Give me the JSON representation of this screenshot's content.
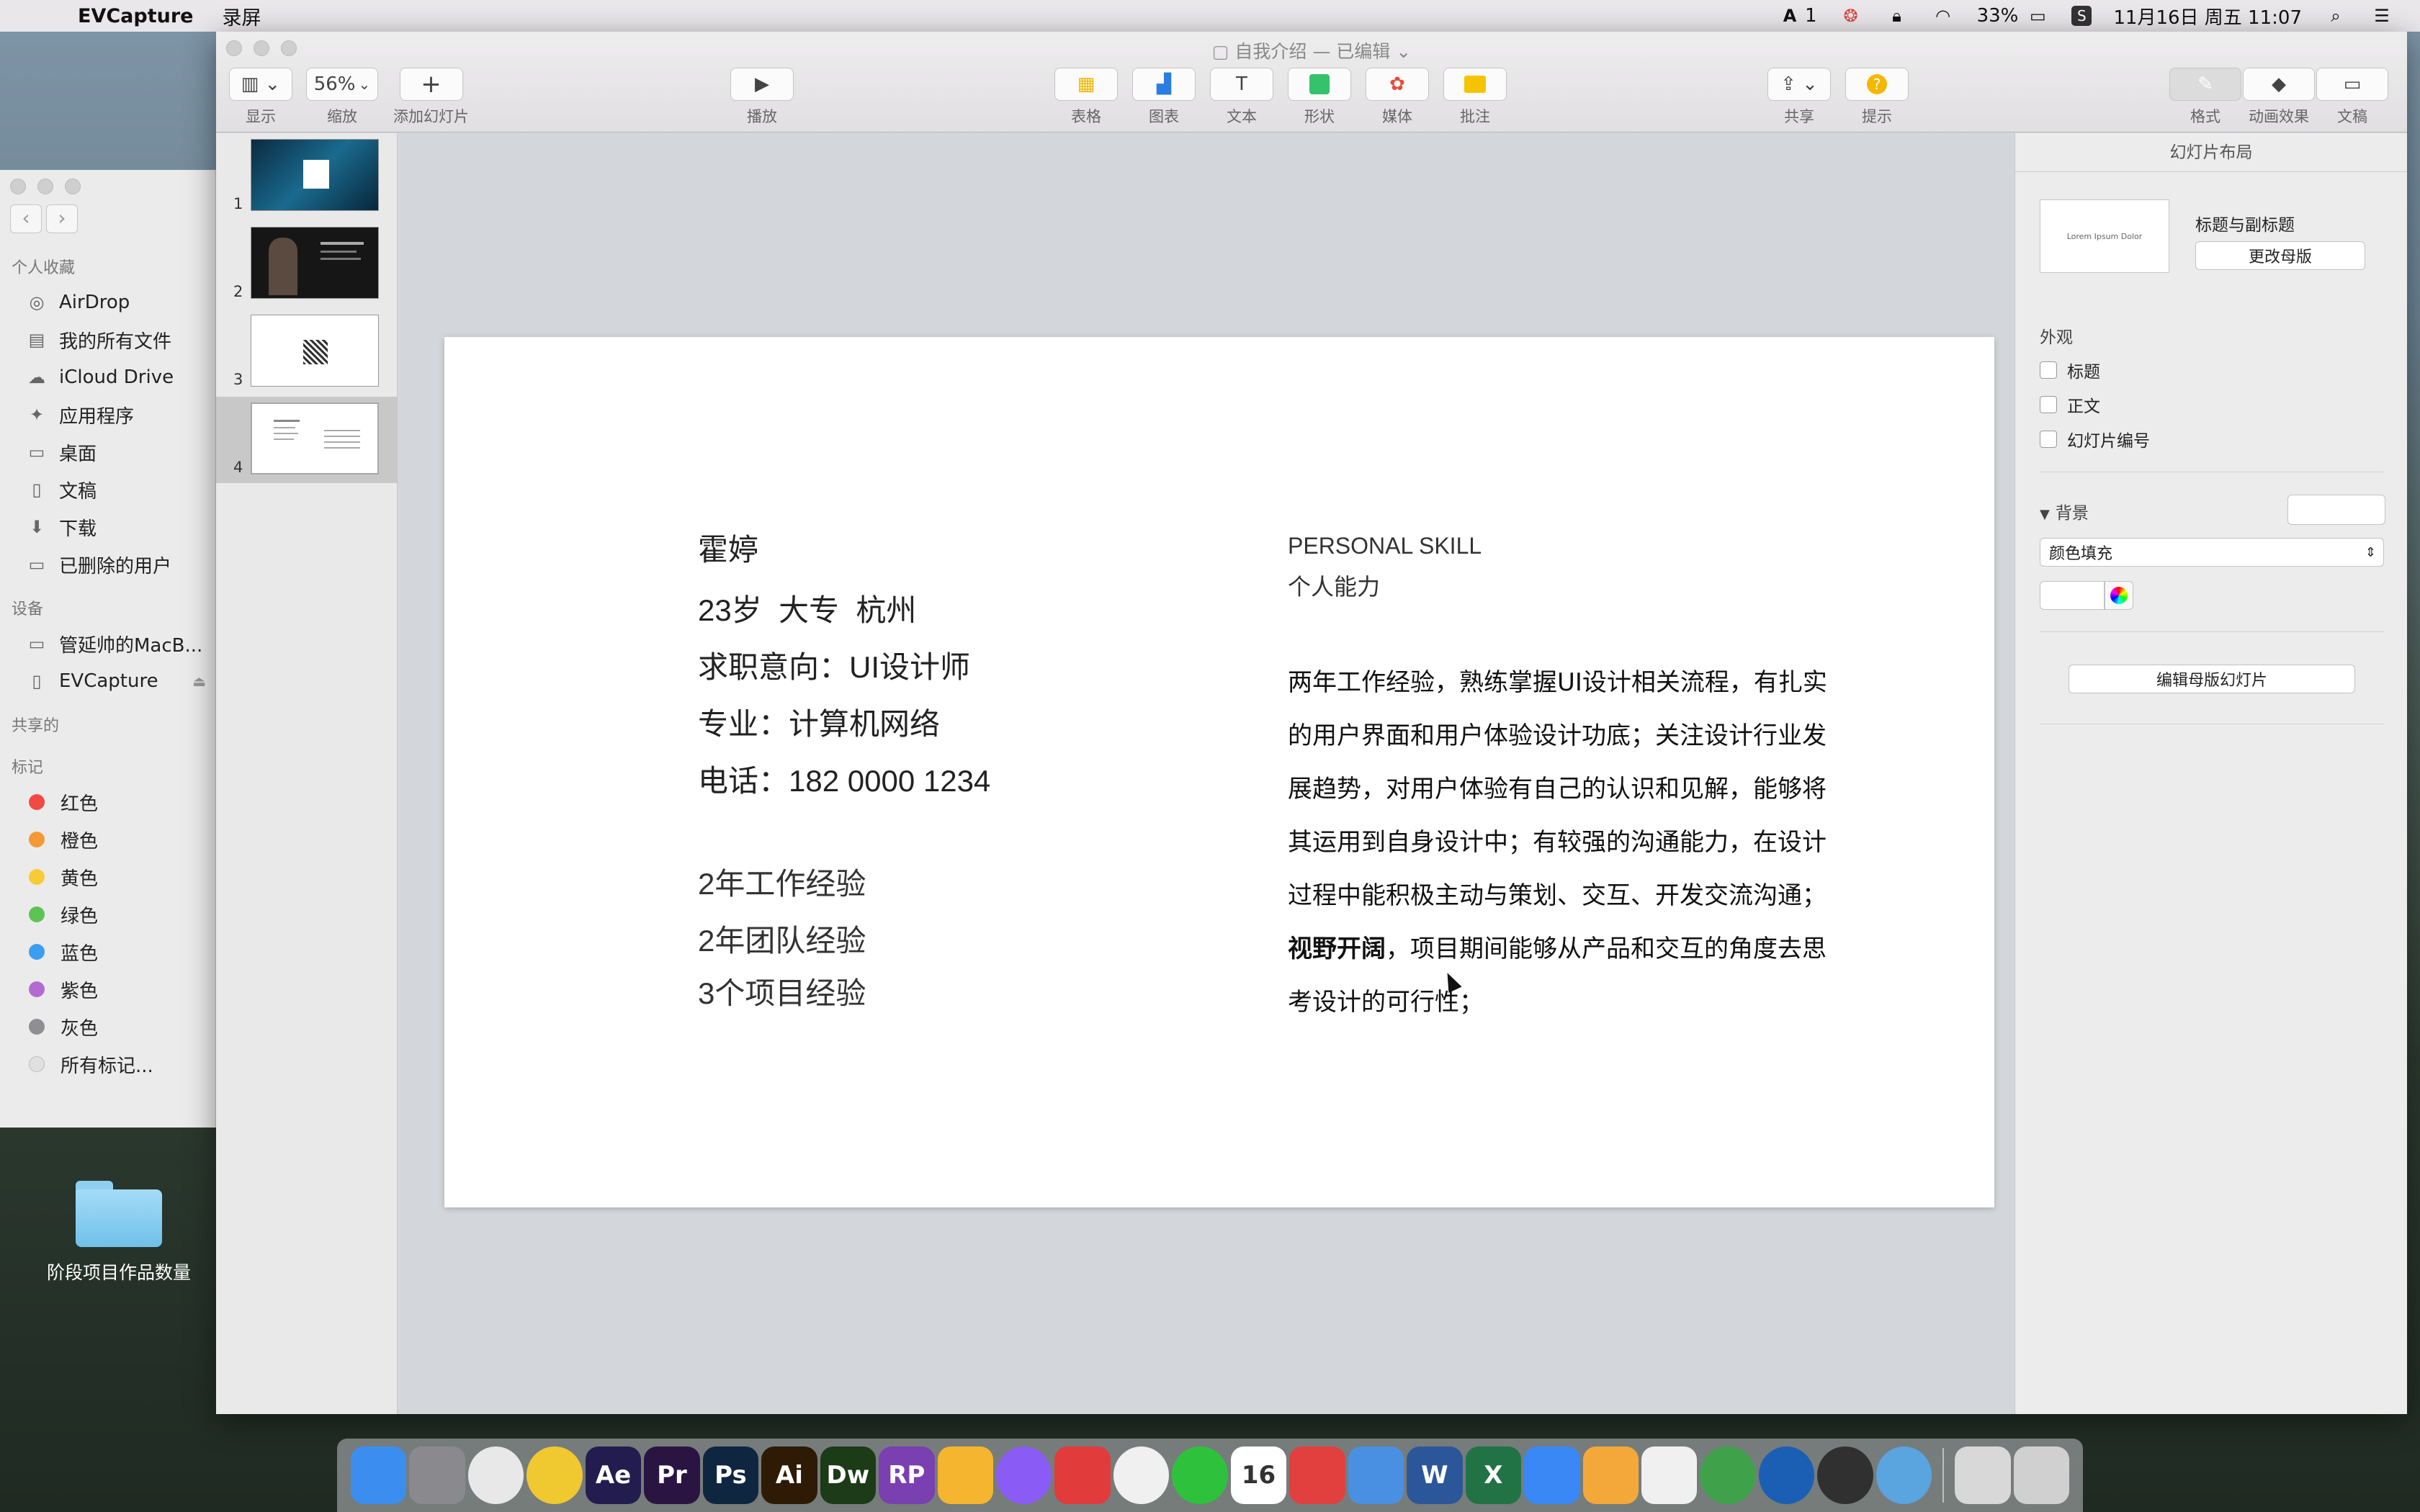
{
  "menubar": {
    "app_name": "EVCapture",
    "menu_item": "录屏",
    "status_text": "1",
    "battery": "33%",
    "datetime": "11月16日 周五 11:07"
  },
  "finder": {
    "sections": {
      "favorites": "个人收藏",
      "devices": "设备",
      "shared": "共享的",
      "tags": "标记"
    },
    "favorites": [
      {
        "label": "AirDrop",
        "icon": "airdrop-icon"
      },
      {
        "label": "我的所有文件",
        "icon": "all-files-icon"
      },
      {
        "label": "iCloud Drive",
        "icon": "cloud-icon"
      },
      {
        "label": "应用程序",
        "icon": "applications-icon"
      },
      {
        "label": "桌面",
        "icon": "desktop-icon"
      },
      {
        "label": "文稿",
        "icon": "documents-icon"
      },
      {
        "label": "下载",
        "icon": "download-icon"
      },
      {
        "label": "已删除的用户",
        "icon": "folder-icon"
      }
    ],
    "devices": [
      {
        "label": "管延帅的MacB...",
        "icon": "laptop-icon"
      },
      {
        "label": "EVCapture",
        "icon": "disk-icon"
      }
    ],
    "tags": [
      {
        "label": "红色",
        "color": "#f04a43"
      },
      {
        "label": "橙色",
        "color": "#f39a34"
      },
      {
        "label": "黄色",
        "color": "#f5cc34"
      },
      {
        "label": "绿色",
        "color": "#5dc453"
      },
      {
        "label": "蓝色",
        "color": "#3a9ef0"
      },
      {
        "label": "紫色",
        "color": "#b36bd1"
      },
      {
        "label": "灰色",
        "color": "#8e8e93"
      },
      {
        "label": "所有标记...",
        "color": "#e0e0e0"
      }
    ]
  },
  "desktop": {
    "folder_label": "阶段项目作品数量"
  },
  "keynote": {
    "title": "自我介绍 — 已编辑",
    "toolbar": {
      "view": "显示",
      "zoom_value": "56%",
      "zoom": "缩放",
      "add_slide": "添加幻灯片",
      "play": "播放",
      "table": "表格",
      "chart": "图表",
      "text": "文本",
      "shape": "形状",
      "media": "媒体",
      "comment": "批注",
      "share": "共享",
      "tips": "提示",
      "format": "格式",
      "animate": "动画效果",
      "document": "文稿"
    },
    "slides": [
      "1",
      "2",
      "3",
      "4"
    ],
    "slide": {
      "name": "霍婷",
      "line1": "23岁  大专  杭州",
      "line2": "求职意向：UI设计师",
      "line3": "专业：计算机网络",
      "line4": "电话：182 0000 1234",
      "exp1": "2年工作经验",
      "exp2": "2年团队经验",
      "exp3": "3个项目经验",
      "skill_title_en": "PERSONAL SKILL",
      "skill_title_cn": "个人能力",
      "para_part1": "两年工作经验，熟练掌握UI设计相关流程，有扎实的用户界面和用户体验设计功底；关注设计行业发展趋势，对用户体验有自己的认识和见解，能够将其运用到自身设计中；有较强的沟通能力，在设计过程中能积极主动与策划、交互、开发交流沟通；",
      "para_bold": "视野开阔",
      "para_part2": "，项目期间能够从产品和交互的角度去思考设计的可行性；"
    },
    "inspector": {
      "header": "幻灯片布局",
      "layout_preview_text": "Lorem Ipsum Dolor",
      "layout_name": "标题与副标题",
      "change_master": "更改母版",
      "appearance": "外观",
      "chk_title": "标题",
      "chk_body": "正文",
      "chk_slide_number": "幻灯片编号",
      "background": "背景",
      "fill_type": "颜色填充",
      "edit_master": "编辑母版幻灯片"
    }
  },
  "dock": {
    "apps": [
      {
        "name": "finder-icon",
        "label": "",
        "color": "#3b8ef0"
      },
      {
        "name": "system-preferences-icon",
        "label": "",
        "color": "#8a8a8e"
      },
      {
        "name": "chrome-icon",
        "label": "",
        "color": "#e8e8e8"
      },
      {
        "name": "app-s-icon",
        "label": "",
        "color": "#f0c830"
      },
      {
        "name": "after-effects-icon",
        "label": "Ae",
        "color": "#221d4e"
      },
      {
        "name": "premiere-icon",
        "label": "Pr",
        "color": "#2a1542"
      },
      {
        "name": "photoshop-icon",
        "label": "Ps",
        "color": "#0f2640"
      },
      {
        "name": "illustrator-icon",
        "label": "Ai",
        "color": "#2e1a05"
      },
      {
        "name": "dreamweaver-icon",
        "label": "Dw",
        "color": "#1c3b17"
      },
      {
        "name": "axure-rp-icon",
        "label": "RP",
        "color": "#7a3fb0"
      },
      {
        "name": "sketch-icon",
        "label": "",
        "color": "#f6b52e"
      },
      {
        "name": "app-p-icon",
        "label": "",
        "color": "#8a5cf5"
      },
      {
        "name": "app-g-icon",
        "label": "",
        "color": "#e23b3b"
      },
      {
        "name": "qq-icon",
        "label": "",
        "color": "#f0f0f0"
      },
      {
        "name": "wechat-icon",
        "label": "",
        "color": "#2ec23c"
      },
      {
        "name": "calendar-icon",
        "label": "16",
        "color": "#ffffff"
      },
      {
        "name": "xmind-icon",
        "label": "",
        "color": "#e23f3f"
      },
      {
        "name": "keynote-icon",
        "label": "",
        "color": "#4a90e2"
      },
      {
        "name": "word-icon",
        "label": "W",
        "color": "#2b579a"
      },
      {
        "name": "excel-icon",
        "label": "X",
        "color": "#217346"
      },
      {
        "name": "baidu-netdisk-icon",
        "label": "",
        "color": "#3a88f5"
      },
      {
        "name": "pages-icon",
        "label": "",
        "color": "#f5a83a"
      },
      {
        "name": "textedit-icon",
        "label": "",
        "color": "#f0f0f0"
      },
      {
        "name": "telegram-icon",
        "label": "",
        "color": "#3fa24b"
      },
      {
        "name": "quicktime-icon",
        "label": "",
        "color": "#1a5fb4"
      },
      {
        "name": "obs-icon",
        "label": "",
        "color": "#303030"
      },
      {
        "name": "evcapture-icon",
        "label": "",
        "color": "#5aa4e0"
      },
      {
        "name": "keyboard-viewer-icon",
        "label": "",
        "color": "#d8d8d8"
      },
      {
        "name": "trash-icon",
        "label": "",
        "color": "#d0d0d0"
      }
    ]
  }
}
